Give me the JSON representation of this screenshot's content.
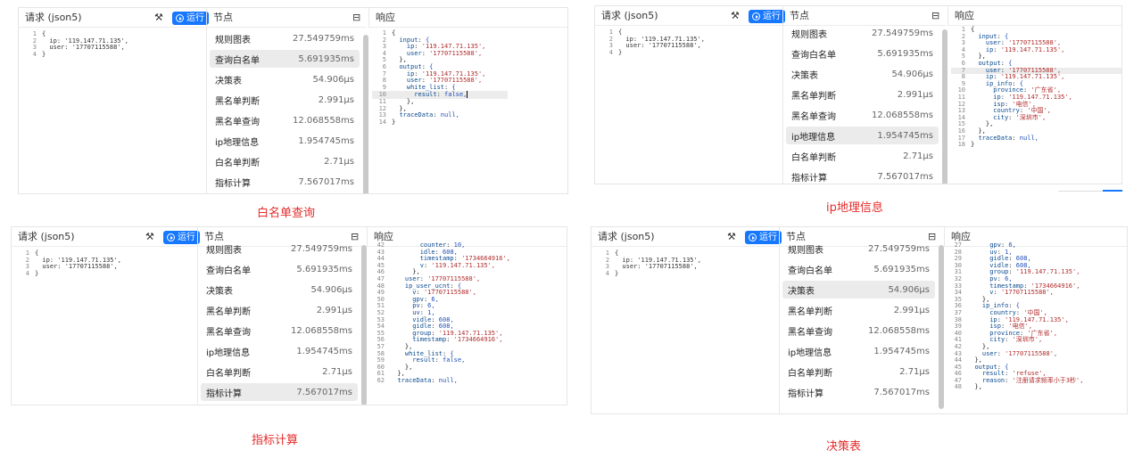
{
  "common": {
    "request_title": "请求 (json5)",
    "run_label": "运行",
    "node_title": "节点",
    "response_title": "响应"
  },
  "panels": [
    {
      "caption": "白名单查询",
      "request_lines": [
        {
          "n": "1",
          "t": "{"
        },
        {
          "n": "2",
          "t": "  ip: '119.147.71.135',"
        },
        {
          "n": "3",
          "t": "  user: '17707115588',"
        },
        {
          "n": "4",
          "t": "}"
        }
      ],
      "nodes": [
        {
          "name": "规则图表",
          "time": "27.549759ms"
        },
        {
          "name": "查询白名单",
          "time": "5.691935ms"
        },
        {
          "name": "决策表",
          "time": "54.906µs"
        },
        {
          "name": "黑名单判断",
          "time": "2.991µs"
        },
        {
          "name": "黑名单查询",
          "time": "12.068558ms"
        },
        {
          "name": "ip地理信息",
          "time": "1.954745ms"
        },
        {
          "name": "白名单判断",
          "time": "2.71µs"
        },
        {
          "name": "指标计算",
          "time": "7.567017ms"
        }
      ],
      "selected_index": 1,
      "response_lines": [
        {
          "n": "1",
          "t": "{"
        },
        {
          "n": "2",
          "t": "  input: {"
        },
        {
          "n": "3",
          "t": "    ip: '119.147.71.135',"
        },
        {
          "n": "4",
          "t": "    user: '17707115588',"
        },
        {
          "n": "5",
          "t": "  },"
        },
        {
          "n": "6",
          "t": "  output: {"
        },
        {
          "n": "7",
          "t": "    ip: '119.147.71.135',"
        },
        {
          "n": "8",
          "t": "    user: '17707115588',"
        },
        {
          "n": "9",
          "t": "    white_list: {"
        },
        {
          "n": "10",
          "t": "      result: false,"
        },
        {
          "n": "11",
          "t": "    },"
        },
        {
          "n": "12",
          "t": "  },"
        },
        {
          "n": "13",
          "t": "  traceData: null,"
        },
        {
          "n": "14",
          "t": "}"
        }
      ]
    },
    {
      "caption": "ip地理信息",
      "request_lines": [
        {
          "n": "1",
          "t": "{"
        },
        {
          "n": "2",
          "t": "  ip: '119.147.71.135',"
        },
        {
          "n": "3",
          "t": "  user: '17707115588',"
        },
        {
          "n": "4",
          "t": "}"
        }
      ],
      "nodes": [
        {
          "name": "规则图表",
          "time": "27.549759ms"
        },
        {
          "name": "查询白名单",
          "time": "5.691935ms"
        },
        {
          "name": "决策表",
          "time": "54.906µs"
        },
        {
          "name": "黑名单判断",
          "time": "2.991µs"
        },
        {
          "name": "黑名单查询",
          "time": "12.068558ms"
        },
        {
          "name": "ip地理信息",
          "time": "1.954745ms"
        },
        {
          "name": "白名单判断",
          "time": "2.71µs"
        },
        {
          "name": "指标计算",
          "time": "7.567017ms"
        }
      ],
      "selected_index": 5,
      "response_lines": [
        {
          "n": "1",
          "t": "{"
        },
        {
          "n": "2",
          "t": "  input: {"
        },
        {
          "n": "3",
          "t": "    user: '17707115588',"
        },
        {
          "n": "4",
          "t": "    ip: '119.147.71.135',"
        },
        {
          "n": "5",
          "t": "  },"
        },
        {
          "n": "6",
          "t": "  output: {"
        },
        {
          "n": "7",
          "t": "    user: '17707115588',"
        },
        {
          "n": "8",
          "t": "    ip: '119.147.71.135',"
        },
        {
          "n": "9",
          "t": "    ip_info: {"
        },
        {
          "n": "10",
          "t": "      province: '广东省',"
        },
        {
          "n": "11",
          "t": "      ip: '119.147.71.135',"
        },
        {
          "n": "12",
          "t": "      isp: '电信',"
        },
        {
          "n": "13",
          "t": "      country: '中国',"
        },
        {
          "n": "14",
          "t": "      city: '深圳市',"
        },
        {
          "n": "15",
          "t": "    },"
        },
        {
          "n": "16",
          "t": "  },"
        },
        {
          "n": "17",
          "t": "  traceData: null,"
        },
        {
          "n": "18",
          "t": "}"
        }
      ]
    },
    {
      "caption": "指标计算",
      "request_lines": [
        {
          "n": "1",
          "t": "{"
        },
        {
          "n": "2",
          "t": "  ip: '119.147.71.135',"
        },
        {
          "n": "3",
          "t": "  user: '17707115588',"
        },
        {
          "n": "4",
          "t": "}"
        }
      ],
      "nodes": [
        {
          "name": "规则图表",
          "time": "27.549759ms"
        },
        {
          "name": "查询白名单",
          "time": "5.691935ms"
        },
        {
          "name": "决策表",
          "time": "54.906µs"
        },
        {
          "name": "黑名单判断",
          "time": "2.991µs"
        },
        {
          "name": "黑名单查询",
          "time": "12.068558ms"
        },
        {
          "name": "ip地理信息",
          "time": "1.954745ms"
        },
        {
          "name": "白名单判断",
          "time": "2.71µs"
        },
        {
          "name": "指标计算",
          "time": "7.567017ms"
        }
      ],
      "selected_index": 7,
      "response_lines": [
        {
          "n": "42",
          "t": "        counter: 10,"
        },
        {
          "n": "43",
          "t": "        idle: 608,"
        },
        {
          "n": "44",
          "t": "        timestamp: '1734664916',"
        },
        {
          "n": "45",
          "t": "        v: '119.147.71.135',"
        },
        {
          "n": "46",
          "t": "      },"
        },
        {
          "n": "47",
          "t": "    user: '17707115588',"
        },
        {
          "n": "48",
          "t": "    ip_user_ucnt: {"
        },
        {
          "n": "49",
          "t": "      v: '17707115588',"
        },
        {
          "n": "50",
          "t": "      gpv: 6,"
        },
        {
          "n": "51",
          "t": "      pv: 6,"
        },
        {
          "n": "52",
          "t": "      uv: 1,"
        },
        {
          "n": "53",
          "t": "      vidle: 608,"
        },
        {
          "n": "54",
          "t": "      gidle: 608,"
        },
        {
          "n": "55",
          "t": "      group: '119.147.71.135',"
        },
        {
          "n": "56",
          "t": "      timestamp: '1734664916',"
        },
        {
          "n": "57",
          "t": "    },"
        },
        {
          "n": "58",
          "t": "    white_list: {"
        },
        {
          "n": "59",
          "t": "      result: false,"
        },
        {
          "n": "60",
          "t": "    },"
        },
        {
          "n": "61",
          "t": "  },"
        },
        {
          "n": "62",
          "t": "  traceData: null,"
        }
      ]
    },
    {
      "caption": "决策表",
      "request_lines": [
        {
          "n": "1",
          "t": "{"
        },
        {
          "n": "2",
          "t": "  ip: '119.147.71.135',"
        },
        {
          "n": "3",
          "t": "  user: '17707115588',"
        },
        {
          "n": "4",
          "t": "}"
        }
      ],
      "nodes": [
        {
          "name": "规则图表",
          "time": "27.549759ms"
        },
        {
          "name": "查询白名单",
          "time": "5.691935ms"
        },
        {
          "name": "决策表",
          "time": "54.906µs"
        },
        {
          "name": "黑名单判断",
          "time": "2.991µs"
        },
        {
          "name": "黑名单查询",
          "time": "12.068558ms"
        },
        {
          "name": "ip地理信息",
          "time": "1.954745ms"
        },
        {
          "name": "白名单判断",
          "time": "2.71µs"
        },
        {
          "name": "指标计算",
          "time": "7.567017ms"
        }
      ],
      "selected_index": 2,
      "response_lines": [
        {
          "n": "27",
          "t": "      gpv: 6,"
        },
        {
          "n": "28",
          "t": "      uv: 1,"
        },
        {
          "n": "29",
          "t": "      gidle: 608,"
        },
        {
          "n": "30",
          "t": "      vidle: 608,"
        },
        {
          "n": "31",
          "t": "      group: '119.147.71.135',"
        },
        {
          "n": "32",
          "t": "      pv: 6,"
        },
        {
          "n": "33",
          "t": "      timestamp: '1734664916',"
        },
        {
          "n": "34",
          "t": "      v: '17707115588',"
        },
        {
          "n": "35",
          "t": "    },"
        },
        {
          "n": "36",
          "t": "    ip_info: {"
        },
        {
          "n": "37",
          "t": "      country: '中国',"
        },
        {
          "n": "38",
          "t": "      ip: '119.147.71.135',"
        },
        {
          "n": "39",
          "t": "      isp: '电信',"
        },
        {
          "n": "40",
          "t": "      province: '广东省',"
        },
        {
          "n": "41",
          "t": "      city: '深圳市',"
        },
        {
          "n": "42",
          "t": "    },"
        },
        {
          "n": "43",
          "t": "    user: '17707115588',"
        },
        {
          "n": "44",
          "t": "  },"
        },
        {
          "n": "45",
          "t": "  output: {"
        },
        {
          "n": "46",
          "t": "    result: 'refuse',"
        },
        {
          "n": "47",
          "t": "    reason: '注册请求频率小于3秒',"
        },
        {
          "n": "48",
          "t": "  },"
        }
      ]
    }
  ]
}
